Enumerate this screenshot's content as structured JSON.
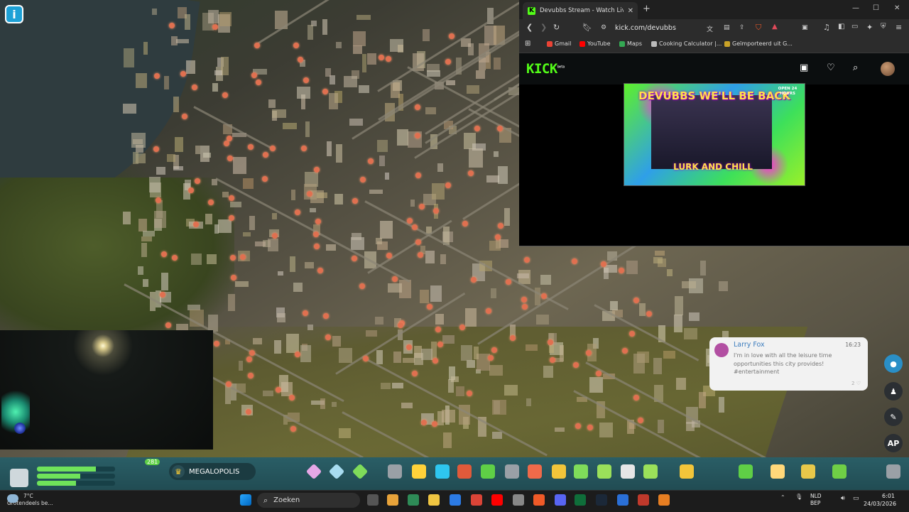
{
  "game": {
    "info_button_label": "i",
    "cash_badge": "281",
    "milestone": "MEGALOPOLIS",
    "population_bars": [
      0.75,
      0.55,
      0.5
    ],
    "ap_button": "AP"
  },
  "chirper": {
    "author": "Larry Fox",
    "time": "16:23",
    "message": "I'm in love with all the leisure time opportunities this city provides! #entertainment",
    "likes": "2 ♡"
  },
  "browser": {
    "tab_title": "Devubbs Stream - Watch Live on",
    "tab_close": "✕",
    "new_tab": "+",
    "url": "kick.com/devubbs",
    "bookmarks": [
      "Gmail",
      "YouTube",
      "Maps",
      "Cooking Calculator |...",
      "Geïmporteerd uit G..."
    ],
    "bookmark_colors": [
      "#ea4335",
      "#ff0000",
      "#34a853",
      "#bbbbbb",
      "#c9a227"
    ],
    "kick_logo": "KICK",
    "kick_beta": "beta",
    "offline_banner": {
      "headline": "DEVUBBS  WE'LL BE BACK",
      "bottom": "LURK AND CHILL",
      "side": "OPEN 24 HOURS"
    }
  },
  "taskbar": {
    "weather_temp": "7°C",
    "weather_desc": "Grotendeels be...",
    "search_placeholder": "Zoeken",
    "lang_line1": "NLD",
    "lang_line2": "BEP",
    "time": "6:01",
    "date": "24/03/2026"
  },
  "colors": {
    "kick_green": "#53fc18",
    "game_bar": "#2a5e66",
    "pin": "#e07050"
  }
}
